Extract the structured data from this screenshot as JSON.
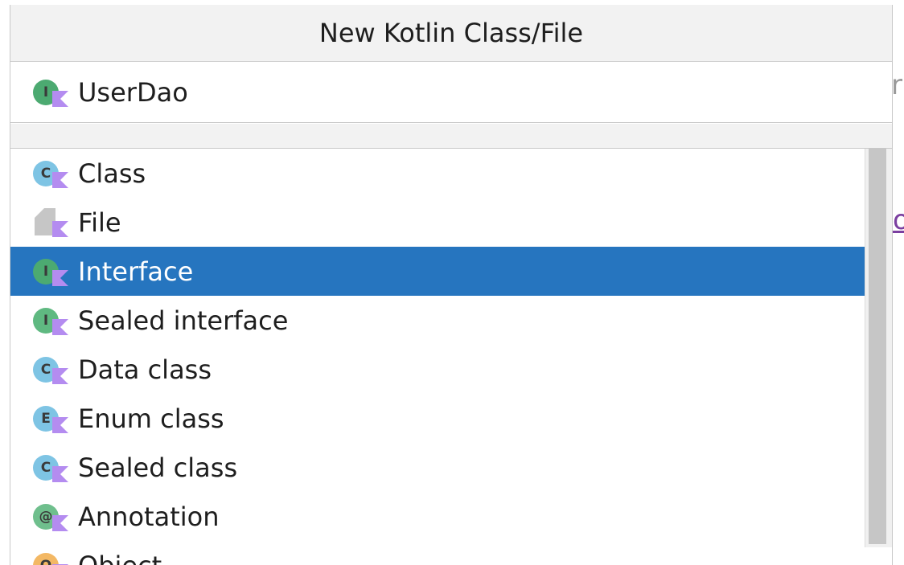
{
  "dialog": {
    "title": "New Kotlin Class/File",
    "name_value": "UserDao",
    "name_icon": "interface-icon"
  },
  "items": [
    {
      "label": "Class",
      "icon": "class-icon",
      "glyph": "C",
      "color": "#7ec4e4"
    },
    {
      "label": "File",
      "icon": "file-icon",
      "glyph": "",
      "color": "#c6c6c6"
    },
    {
      "label": "Interface",
      "icon": "interface-icon",
      "glyph": "I",
      "color": "#4caa71",
      "selected": true
    },
    {
      "label": "Sealed interface",
      "icon": "sealed-interface-icon",
      "glyph": "I",
      "color": "#5fb981"
    },
    {
      "label": "Data class",
      "icon": "data-class-icon",
      "glyph": "C",
      "color": "#7ec4e4"
    },
    {
      "label": "Enum class",
      "icon": "enum-class-icon",
      "glyph": "E",
      "color": "#7ec4e4"
    },
    {
      "label": "Sealed class",
      "icon": "sealed-class-icon",
      "glyph": "C",
      "color": "#7ec4e4"
    },
    {
      "label": "Annotation",
      "icon": "annotation-icon",
      "glyph": "@",
      "color": "#6fbf8d"
    },
    {
      "label": "Object",
      "icon": "object-icon",
      "glyph": "O",
      "color": "#f3b864"
    }
  ],
  "colors": {
    "selection": "#2675bf",
    "kotlin_badge": "#b48cf0",
    "interface": "#4caa71",
    "class": "#7ec4e4"
  }
}
